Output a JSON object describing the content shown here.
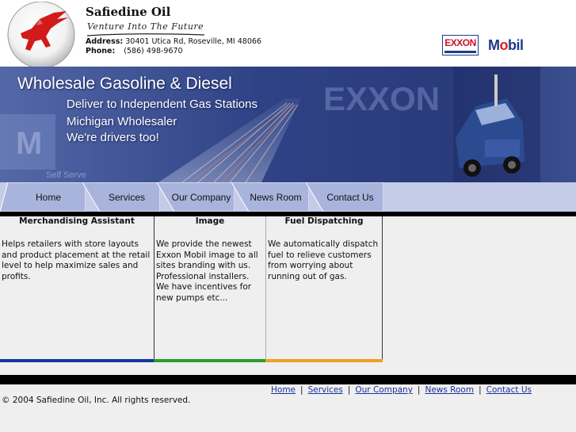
{
  "header": {
    "company_name": "Safiedine Oil",
    "tagline": "Venture Into The Future",
    "address_label": "Address:",
    "address_value": "30401 Utica Rd, Roseville, MI 48066",
    "phone_label": "Phone:",
    "phone_value": "(586) 498-9670",
    "logos": [
      {
        "name": "exxon-logo",
        "text": "EXXON"
      },
      {
        "name": "mobil-logo",
        "text_prefix": "M",
        "text_o": "o",
        "text_suffix": "bil"
      }
    ]
  },
  "banner": {
    "headline": "Wholesale Gasoline & Diesel",
    "lines": [
      "Deliver to Independent Gas Stations",
      "Michigan Wholesaler",
      "We're drivers too!"
    ]
  },
  "nav": {
    "tabs": [
      {
        "label": "Home"
      },
      {
        "label": "Services"
      },
      {
        "label": "Our Company"
      },
      {
        "label": "News Room"
      },
      {
        "label": "Contact Us"
      }
    ]
  },
  "content": {
    "columns": [
      {
        "title": "Merchandising Assistant",
        "body": "Helps retailers with store layouts and product placement at the retail level to help maximize sales and profits."
      },
      {
        "title": "Image",
        "body": "We provide the newest Exxon Mobil image to all sites branding with us. Professional installers. We have incentives for new pumps etc..."
      },
      {
        "title": "Fuel Dispatching",
        "body": "We automatically dispatch fuel to relieve customers from worrying about running out of gas."
      }
    ]
  },
  "footer": {
    "links": [
      "Home",
      "Services",
      "Our Company",
      "News Room",
      "Contact Us"
    ],
    "separator": "|",
    "copyright": "© 2004 Safiedine Oil, Inc. All rights reserved."
  },
  "colors": {
    "nav_tab": "#a9b4dd",
    "nav_bg": "#c4cbe6",
    "banner": "#3a4f8e",
    "bar1": "#1236a0",
    "bar2": "#2d9a2d",
    "bar3": "#f0a020",
    "link": "#1a2f9a"
  }
}
